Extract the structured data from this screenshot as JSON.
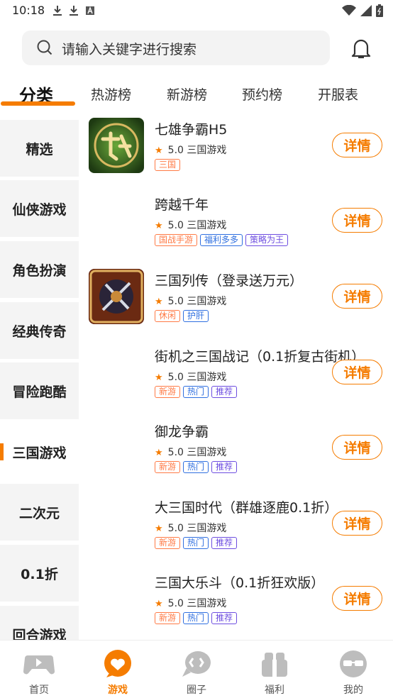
{
  "status": {
    "time": "10:18",
    "left_icons": [
      "download-icon",
      "download-icon",
      "a-icon"
    ],
    "right_icons": [
      "wifi-icon",
      "signal-icon",
      "battery-icon"
    ]
  },
  "search": {
    "placeholder": "请输入关键字进行搜索"
  },
  "tabs": [
    "分类",
    "热游榜",
    "新游榜",
    "预约榜",
    "开服表"
  ],
  "categories": [
    "精选",
    "仙侠游戏",
    "角色扮演",
    "经典传奇",
    "冒险跑酷",
    "三国游戏",
    "二次元",
    "0.1折",
    "回合游戏"
  ],
  "active_category": "三国游戏",
  "games": [
    {
      "name": "七雄争霸H5",
      "rating": "5.0",
      "genre": "三国游戏",
      "tags": [
        {
          "t": "三国",
          "c": "orange"
        }
      ],
      "detail": "详情"
    },
    {
      "name": "跨越千年",
      "rating": "5.0",
      "genre": "三国游戏",
      "tags": [
        {
          "t": "国战手游",
          "c": "orange"
        },
        {
          "t": "福利多多",
          "c": "blue"
        },
        {
          "t": "策略为王",
          "c": "purple"
        }
      ],
      "detail": "详情"
    },
    {
      "name": "三国列传（登录送万元）",
      "rating": "5.0",
      "genre": "三国游戏",
      "tags": [
        {
          "t": "休闲",
          "c": "orange"
        },
        {
          "t": "护肝",
          "c": "blue"
        }
      ],
      "detail": "详情"
    },
    {
      "name": "街机之三国战记（0.1折复古街机）",
      "rating": "5.0",
      "genre": "三国游戏",
      "tags": [
        {
          "t": "新游",
          "c": "orange"
        },
        {
          "t": "热门",
          "c": "blue"
        },
        {
          "t": "推荐",
          "c": "purple"
        }
      ],
      "detail": "详情"
    },
    {
      "name": "御龙争霸",
      "rating": "5.0",
      "genre": "三国游戏",
      "tags": [
        {
          "t": "新游",
          "c": "orange"
        },
        {
          "t": "热门",
          "c": "blue"
        },
        {
          "t": "推荐",
          "c": "purple"
        }
      ],
      "detail": "详情"
    },
    {
      "name": "大三国时代（群雄逐鹿0.1折）",
      "rating": "5.0",
      "genre": "三国游戏",
      "tags": [
        {
          "t": "新游",
          "c": "orange"
        },
        {
          "t": "热门",
          "c": "blue"
        },
        {
          "t": "推荐",
          "c": "purple"
        }
      ],
      "detail": "详情"
    },
    {
      "name": "三国大乐斗（0.1折狂欢版）",
      "rating": "5.0",
      "genre": "三国游戏",
      "tags": [
        {
          "t": "新游",
          "c": "orange"
        },
        {
          "t": "热门",
          "c": "blue"
        },
        {
          "t": "推荐",
          "c": "purple"
        }
      ],
      "detail": "详情"
    }
  ],
  "bottom_nav": [
    {
      "label": "首页",
      "icon": "gamepad-icon"
    },
    {
      "label": "游戏",
      "icon": "heart-chat-icon"
    },
    {
      "label": "圈子",
      "icon": "chat-bubble-icon"
    },
    {
      "label": "福利",
      "icon": "gift-icon"
    },
    {
      "label": "我的",
      "icon": "face-icon"
    }
  ],
  "active_nav": "游戏",
  "accent_color": "#f57c00"
}
